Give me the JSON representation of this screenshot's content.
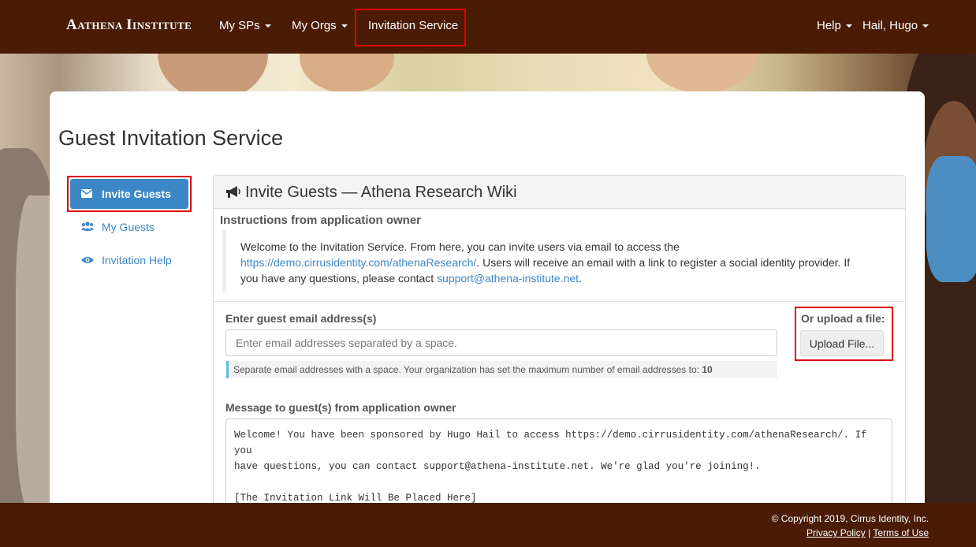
{
  "header": {
    "logo_prefix": "Athena",
    "logo_suffix": "Institute",
    "nav": {
      "my_sps": "My SPs",
      "my_orgs": "My Orgs",
      "invitation_service": "Invitation Service",
      "help": "Help",
      "user": "Hail, Hugo"
    }
  },
  "page": {
    "title": "Guest Invitation Service"
  },
  "sidebar": {
    "items": [
      {
        "label": "Invite Guests",
        "icon": "envelope-icon"
      },
      {
        "label": "My Guests",
        "icon": "users-icon"
      },
      {
        "label": "Invitation Help",
        "icon": "eye-icon"
      }
    ]
  },
  "panel": {
    "title": "Invite Guests — Athena Research Wiki",
    "instructions_label": "Instructions from application owner",
    "instructions": {
      "part1": "Welcome to the Invitation Service. From here, you can invite users via email to access the",
      "link": "https://demo.cirrusidentity.com/athenaResearch/",
      "part2": ". Users will receive an email with a link to register a social identity provider. If you have any questions, please contact ",
      "email": "support@athena-institute.net",
      "part3": "."
    },
    "email_label": "Enter guest email address(s)",
    "email_placeholder": "Enter email addresses separated by a space.",
    "email_help": "Separate email addresses with a space. Your organization has set the maximum number of email addresses to: ",
    "email_max": "10",
    "upload_label": "Or upload a file:",
    "upload_button": "Upload File...",
    "message_label": "Message to guest(s) from application owner",
    "message_text": "Welcome! You have been sponsored by Hugo Hail to access https://demo.cirrusidentity.com/athenaResearch/. If you\nhave questions, you can contact support@athena-institute.net. We're glad you're joining!.\n\n[The Invitation Link Will Be Placed Here]"
  },
  "footer": {
    "copyright": "© Copyright 2019, Cirrus Identity, Inc.",
    "privacy": "Privacy Policy",
    "separator": "|",
    "terms": "Terms of Use"
  },
  "colors": {
    "nav_bg": "#4a1c05",
    "accent": "#3c87c8",
    "highlight": "#e00000"
  }
}
